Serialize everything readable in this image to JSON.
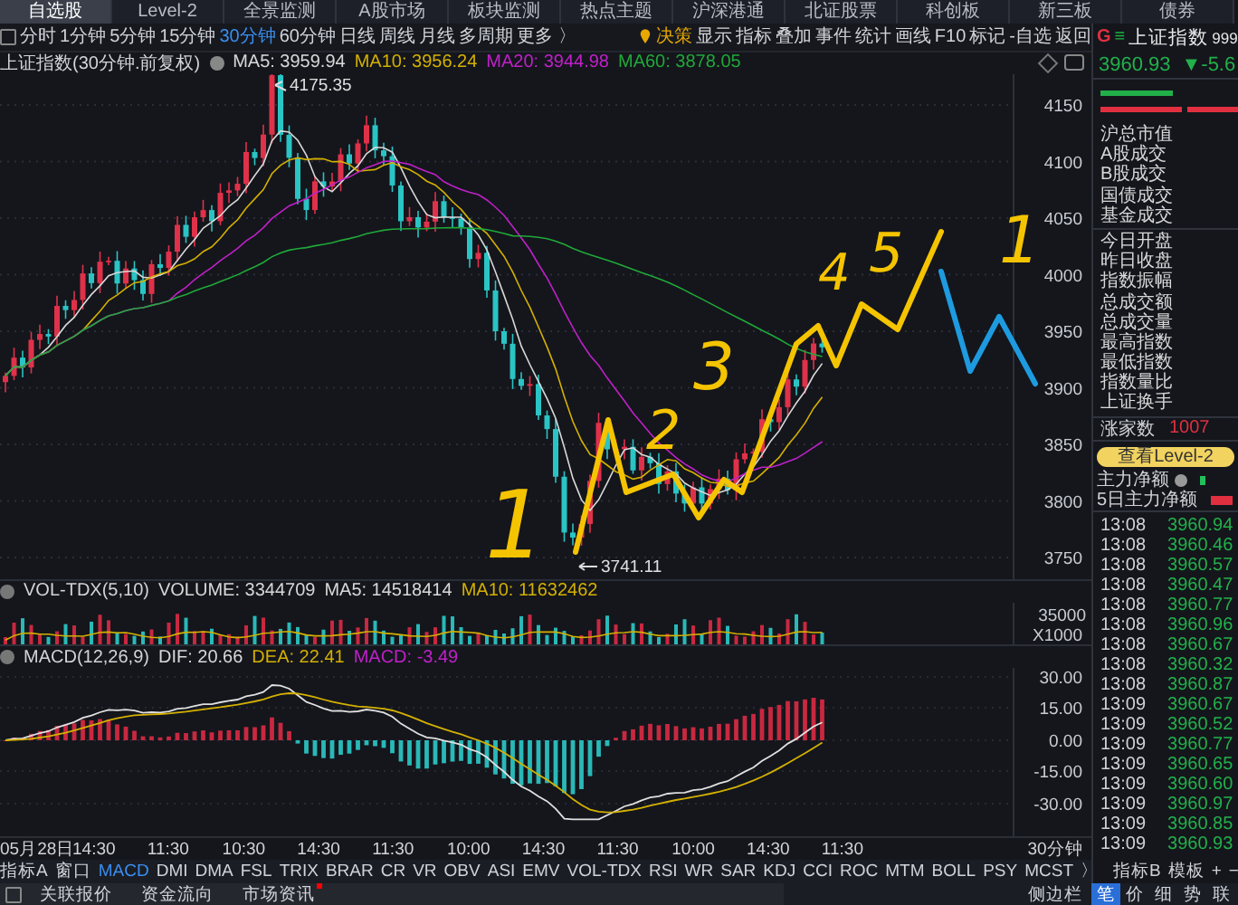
{
  "top_tabs": [
    {
      "label": "自选股",
      "selected": true
    },
    {
      "label": "Level-2",
      "selected": false
    },
    {
      "label": "全景监测",
      "selected": false
    },
    {
      "label": "A股市场",
      "selected": false
    },
    {
      "label": "板块监测",
      "selected": false
    },
    {
      "label": "热点主题",
      "selected": false
    },
    {
      "label": "沪深港通",
      "selected": false
    },
    {
      "label": "北证股票",
      "selected": false
    },
    {
      "label": "科创板",
      "selected": false
    },
    {
      "label": "新三板",
      "selected": false
    },
    {
      "label": "债券",
      "selected": false
    }
  ],
  "period_tabs": [
    {
      "label": "分时",
      "selected": false
    },
    {
      "label": "1分钟",
      "selected": false
    },
    {
      "label": "5分钟",
      "selected": false
    },
    {
      "label": "15分钟",
      "selected": false
    },
    {
      "label": "30分钟",
      "selected": true
    },
    {
      "label": "60分钟",
      "selected": false
    },
    {
      "label": "日线",
      "selected": false
    },
    {
      "label": "周线",
      "selected": false
    },
    {
      "label": "月线",
      "selected": false
    },
    {
      "label": "多周期",
      "selected": false
    },
    {
      "label": "更多 〉",
      "selected": false
    }
  ],
  "toolbar": {
    "decision": "决策",
    "items": [
      "显示",
      "指标",
      "叠加",
      "事件",
      "统计",
      "画线",
      "F10",
      "标记",
      "-自选",
      "返回"
    ]
  },
  "price_chart": {
    "title": "上证指数(30分钟.前复权)",
    "indicators": [
      {
        "label": "MA5: 3959.94",
        "color": "#d8d8d8"
      },
      {
        "label": "MA10: 3956.24",
        "color": "#d4b000"
      },
      {
        "label": "MA20: 3944.98",
        "color": "#c020c8"
      },
      {
        "label": "MA60: 3878.05",
        "color": "#20a838"
      }
    ],
    "high_label": "4175.35",
    "low_label": "3741.11",
    "axis": [
      "4150",
      "4100",
      "4050",
      "4000",
      "3950",
      "3900",
      "3850",
      "3800",
      "3750"
    ]
  },
  "volume": {
    "title": "VOL-TDX(5,10)",
    "indicators": [
      {
        "label": "VOLUME: 3344709",
        "color": "#d8d8d8"
      },
      {
        "label": "MA5: 14518414",
        "color": "#d8d8d8"
      },
      {
        "label": "MA10: 11632462",
        "color": "#d4b000"
      }
    ],
    "axis": [
      "35000"
    ],
    "unit": "X1000"
  },
  "macd": {
    "title": "MACD(12,26,9)",
    "indicators": [
      {
        "label": "DIF: 20.66",
        "color": "#d8d8d8"
      },
      {
        "label": "DEA: 22.41",
        "color": "#d4b000"
      },
      {
        "label": "MACD: -3.49",
        "color": "#c020c8"
      }
    ],
    "axis": [
      "30.00",
      "15.00",
      "0.00",
      "-15.00",
      "-30.00"
    ]
  },
  "time_axis": {
    "labels": [
      "05月28日",
      "14:30",
      "11:30",
      "10:30",
      "14:30",
      "11:30",
      "10:00",
      "14:30",
      "11:30",
      "10:00",
      "14:30",
      "11:30"
    ],
    "period": "30分钟"
  },
  "indicator_bar": {
    "lead": [
      "指标A",
      "窗口"
    ],
    "tabs": [
      {
        "label": "MACD",
        "selected": true
      },
      {
        "label": "DMI",
        "selected": false
      },
      {
        "label": "DMA",
        "selected": false
      },
      {
        "label": "FSL",
        "selected": false
      },
      {
        "label": "TRIX",
        "selected": false
      },
      {
        "label": "BRAR",
        "selected": false
      },
      {
        "label": "CR",
        "selected": false
      },
      {
        "label": "VR",
        "selected": false
      },
      {
        "label": "OBV",
        "selected": false
      },
      {
        "label": "ASI",
        "selected": false
      },
      {
        "label": "EMV",
        "selected": false
      },
      {
        "label": "VOL-TDX",
        "selected": false
      },
      {
        "label": "RSI",
        "selected": false
      },
      {
        "label": "WR",
        "selected": false
      },
      {
        "label": "SAR",
        "selected": false
      },
      {
        "label": "KDJ",
        "selected": false
      },
      {
        "label": "CCI",
        "selected": false
      },
      {
        "label": "ROC",
        "selected": false
      },
      {
        "label": "MTM",
        "selected": false
      },
      {
        "label": "BOLL",
        "selected": false
      },
      {
        "label": "PSY",
        "selected": false
      },
      {
        "label": "MCST",
        "selected": false
      }
    ],
    "more": "〉",
    "trailing": [
      "指标B",
      "模板"
    ],
    "zoom": [
      "+",
      "−"
    ]
  },
  "bottom_tabs": [
    {
      "label": "关联报价",
      "badge": false
    },
    {
      "label": "资金流向",
      "badge": false
    },
    {
      "label": "市场资讯",
      "badge": true
    }
  ],
  "sidebar_toggle": "侧边栏",
  "quote": {
    "flag": "G",
    "menu": "≡",
    "name": "上证指数",
    "code": "999",
    "price": "3960.93",
    "change": "▼-5.6"
  },
  "market_rows": [
    "沪总市值",
    "A股成交",
    "B股成交",
    "国债成交",
    "基金成交"
  ],
  "stat_rows": [
    "今日开盘",
    "昨日收盘",
    "指数振幅",
    "总成交额",
    "总成交量",
    "最高指数",
    "最低指数",
    "指数量比",
    "上证换手"
  ],
  "advancers": {
    "label": "涨家数",
    "value": "1007"
  },
  "level2_button": "查看Level-2",
  "flows": [
    {
      "label": "主力净额",
      "info": true,
      "color": "#22c05a"
    },
    {
      "label": "5日主力净额",
      "info": false,
      "color": "#e03040"
    }
  ],
  "ticks": [
    {
      "time": "13:08",
      "price": "3960.94"
    },
    {
      "time": "13:08",
      "price": "3960.46"
    },
    {
      "time": "13:08",
      "price": "3960.57"
    },
    {
      "time": "13:08",
      "price": "3960.47"
    },
    {
      "time": "13:08",
      "price": "3960.77"
    },
    {
      "time": "13:08",
      "price": "3960.96"
    },
    {
      "time": "13:08",
      "price": "3960.67"
    },
    {
      "time": "13:08",
      "price": "3960.32"
    },
    {
      "time": "13:08",
      "price": "3960.87"
    },
    {
      "time": "13:09",
      "price": "3960.67"
    },
    {
      "time": "13:09",
      "price": "3960.52"
    },
    {
      "time": "13:09",
      "price": "3960.77"
    },
    {
      "time": "13:09",
      "price": "3960.65"
    },
    {
      "time": "13:09",
      "price": "3960.60"
    },
    {
      "time": "13:09",
      "price": "3960.97"
    },
    {
      "time": "13:09",
      "price": "3960.85"
    },
    {
      "time": "13:09",
      "price": "3960.93"
    }
  ],
  "detail_tabs": [
    {
      "label": "笔",
      "selected": true
    },
    {
      "label": "价",
      "selected": false
    },
    {
      "label": "细",
      "selected": false
    },
    {
      "label": "势",
      "selected": false
    },
    {
      "label": "联",
      "selected": false
    }
  ],
  "annotations": [
    "1",
    "2",
    "3",
    "4",
    "5",
    "1"
  ]
}
